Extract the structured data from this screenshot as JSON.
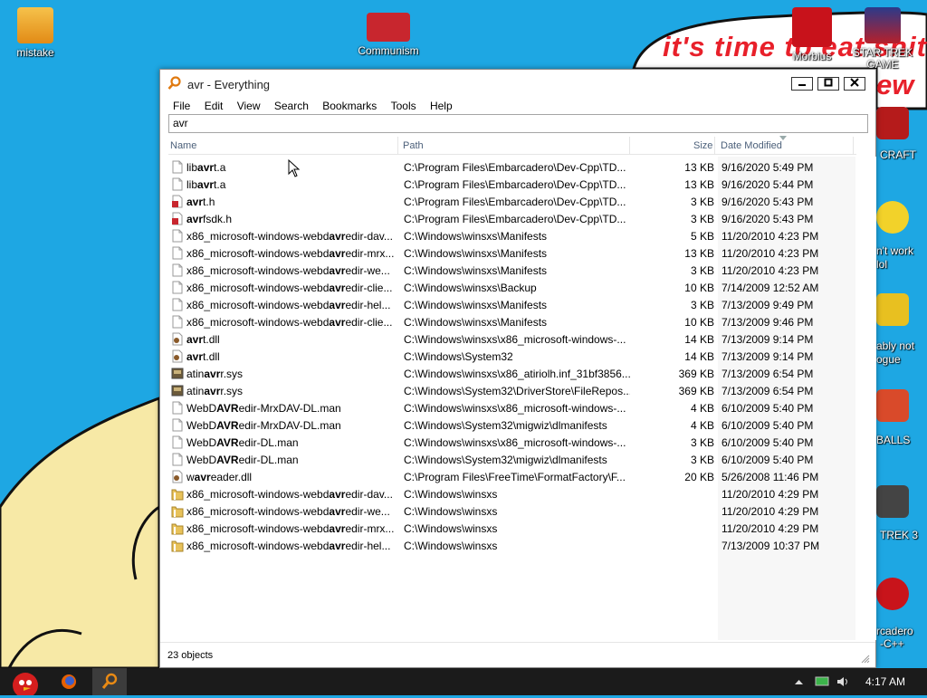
{
  "desktop": {
    "icons": [
      {
        "id": "mistake",
        "label": "mistake"
      },
      {
        "id": "communism",
        "label": "Communism"
      },
      {
        "id": "morbius",
        "label": "Morbius"
      },
      {
        "id": "star-trek-game",
        "label": "STAR TREK GAME"
      }
    ],
    "side_labels": [
      "CRAFT",
      "n't work",
      "lol",
      "ably not",
      "ogue",
      "BALLS",
      "TREK 3",
      "rcadero",
      "-C++"
    ],
    "wallpaper_text_1": "it's time to eat shit",
    "wallpaper_text_2": "ew"
  },
  "window": {
    "title": "avr - Everything",
    "menu": [
      "File",
      "Edit",
      "View",
      "Search",
      "Bookmarks",
      "Tools",
      "Help"
    ],
    "search_value": "avr",
    "columns": {
      "name": "Name",
      "path": "Path",
      "size": "Size",
      "date": "Date Modified"
    },
    "status": "23 objects",
    "rows": [
      {
        "pre": "lib",
        "hl": "avr",
        "post": "t.a",
        "path": "C:\\Program Files\\Embarcadero\\Dev-Cpp\\TD...",
        "size": "13 KB",
        "date": "9/16/2020 5:49 PM",
        "icon": "file-icon"
      },
      {
        "pre": "lib",
        "hl": "avr",
        "post": "t.a",
        "path": "C:\\Program Files\\Embarcadero\\Dev-Cpp\\TD...",
        "size": "13 KB",
        "date": "9/16/2020 5:44 PM",
        "icon": "file-icon"
      },
      {
        "pre": "",
        "hl": "avr",
        "post": "t.h",
        "path": "C:\\Program Files\\Embarcadero\\Dev-Cpp\\TD...",
        "size": "3 KB",
        "date": "9/16/2020 5:43 PM",
        "icon": "header-file-icon"
      },
      {
        "pre": "",
        "hl": "avr",
        "post": "fsdk.h",
        "path": "C:\\Program Files\\Embarcadero\\Dev-Cpp\\TD...",
        "size": "3 KB",
        "date": "9/16/2020 5:43 PM",
        "icon": "header-file-icon"
      },
      {
        "pre": "x86_microsoft-windows-webd",
        "hl": "avr",
        "post": "edir-dav...",
        "path": "C:\\Windows\\winsxs\\Manifests",
        "size": "5 KB",
        "date": "11/20/2010 4:23 PM",
        "icon": "file-icon"
      },
      {
        "pre": "x86_microsoft-windows-webd",
        "hl": "avr",
        "post": "edir-mrx...",
        "path": "C:\\Windows\\winsxs\\Manifests",
        "size": "13 KB",
        "date": "11/20/2010 4:23 PM",
        "icon": "file-icon"
      },
      {
        "pre": "x86_microsoft-windows-webd",
        "hl": "avr",
        "post": "edir-we...",
        "path": "C:\\Windows\\winsxs\\Manifests",
        "size": "3 KB",
        "date": "11/20/2010 4:23 PM",
        "icon": "file-icon"
      },
      {
        "pre": "x86_microsoft-windows-webd",
        "hl": "avr",
        "post": "edir-clie...",
        "path": "C:\\Windows\\winsxs\\Backup",
        "size": "10 KB",
        "date": "7/14/2009 12:52 AM",
        "icon": "file-icon"
      },
      {
        "pre": "x86_microsoft-windows-webd",
        "hl": "avr",
        "post": "edir-hel...",
        "path": "C:\\Windows\\winsxs\\Manifests",
        "size": "3 KB",
        "date": "7/13/2009 9:49 PM",
        "icon": "file-icon"
      },
      {
        "pre": "x86_microsoft-windows-webd",
        "hl": "avr",
        "post": "edir-clie...",
        "path": "C:\\Windows\\winsxs\\Manifests",
        "size": "10 KB",
        "date": "7/13/2009 9:46 PM",
        "icon": "file-icon"
      },
      {
        "pre": "",
        "hl": "avr",
        "post": "t.dll",
        "path": "C:\\Windows\\winsxs\\x86_microsoft-windows-...",
        "size": "14 KB",
        "date": "7/13/2009 9:14 PM",
        "icon": "dll-icon"
      },
      {
        "pre": "",
        "hl": "avr",
        "post": "t.dll",
        "path": "C:\\Windows\\System32",
        "size": "14 KB",
        "date": "7/13/2009 9:14 PM",
        "icon": "dll-icon"
      },
      {
        "pre": "atin",
        "hl": "avr",
        "post": "r.sys",
        "path": "C:\\Windows\\winsxs\\x86_atiriolh.inf_31bf3856...",
        "size": "369 KB",
        "date": "7/13/2009 6:54 PM",
        "icon": "sys-file-icon"
      },
      {
        "pre": "atin",
        "hl": "avr",
        "post": "r.sys",
        "path": "C:\\Windows\\System32\\DriverStore\\FileRepos...",
        "size": "369 KB",
        "date": "7/13/2009 6:54 PM",
        "icon": "sys-file-icon"
      },
      {
        "pre": "WebD",
        "hl": "AVR",
        "post": "edir-MrxDAV-DL.man",
        "path": "C:\\Windows\\winsxs\\x86_microsoft-windows-...",
        "size": "4 KB",
        "date": "6/10/2009 5:40 PM",
        "icon": "file-icon"
      },
      {
        "pre": "WebD",
        "hl": "AVR",
        "post": "edir-MrxDAV-DL.man",
        "path": "C:\\Windows\\System32\\migwiz\\dlmanifests",
        "size": "4 KB",
        "date": "6/10/2009 5:40 PM",
        "icon": "file-icon"
      },
      {
        "pre": "WebD",
        "hl": "AVR",
        "post": "edir-DL.man",
        "path": "C:\\Windows\\winsxs\\x86_microsoft-windows-...",
        "size": "3 KB",
        "date": "6/10/2009 5:40 PM",
        "icon": "file-icon"
      },
      {
        "pre": "WebD",
        "hl": "AVR",
        "post": "edir-DL.man",
        "path": "C:\\Windows\\System32\\migwiz\\dlmanifests",
        "size": "3 KB",
        "date": "6/10/2009 5:40 PM",
        "icon": "file-icon"
      },
      {
        "pre": "w",
        "hl": "avr",
        "post": "eader.dll",
        "path": "C:\\Program Files\\FreeTime\\FormatFactory\\F...",
        "size": "20 KB",
        "date": "5/26/2008 11:46 PM",
        "icon": "dll-icon"
      },
      {
        "pre": "x86_microsoft-windows-webd",
        "hl": "avr",
        "post": "edir-dav...",
        "path": "C:\\Windows\\winsxs",
        "size": "",
        "date": "11/20/2010 4:29 PM",
        "icon": "folder-icon"
      },
      {
        "pre": "x86_microsoft-windows-webd",
        "hl": "avr",
        "post": "edir-we...",
        "path": "C:\\Windows\\winsxs",
        "size": "",
        "date": "11/20/2010 4:29 PM",
        "icon": "folder-icon"
      },
      {
        "pre": "x86_microsoft-windows-webd",
        "hl": "avr",
        "post": "edir-mrx...",
        "path": "C:\\Windows\\winsxs",
        "size": "",
        "date": "11/20/2010 4:29 PM",
        "icon": "folder-icon"
      },
      {
        "pre": "x86_microsoft-windows-webd",
        "hl": "avr",
        "post": "edir-hel...",
        "path": "C:\\Windows\\winsxs",
        "size": "",
        "date": "7/13/2009 10:37 PM",
        "icon": "folder-icon"
      }
    ]
  },
  "taskbar": {
    "clock": "4:17 AM"
  }
}
